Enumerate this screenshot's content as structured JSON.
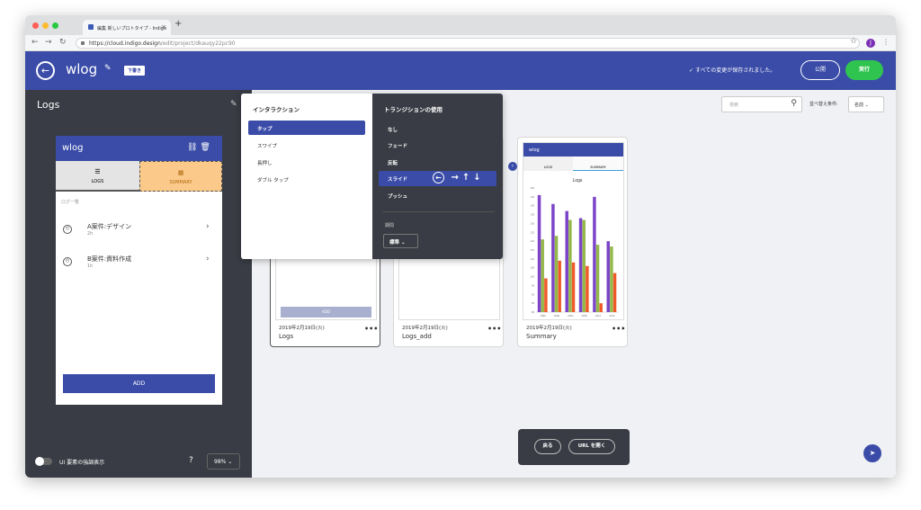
{
  "browser": {
    "tab_title": "編集 新しいプロトタイプ - Indigo",
    "tab_close": "×",
    "new_tab": "+",
    "url_host": "https://cloud.indigo.design",
    "url_path": "/edit/project/dkauqy22pc90",
    "profile_initial": "J",
    "colors": {
      "close": "#fd5e56",
      "minimize": "#fdbb2e",
      "maximize": "#28c941"
    }
  },
  "header": {
    "project_title": "wlog",
    "draft_badge": "下書き",
    "saved_status": "すべての変更が保存されました。",
    "publish_label": "公開",
    "run_label": "実行",
    "colors": {
      "bar": "#3a4ca8",
      "run": "#2fc44f"
    }
  },
  "sidebar": {
    "title": "Logs",
    "phone": {
      "title": "wlog",
      "tabs": [
        {
          "label": "LOGS",
          "icon": "list-icon"
        },
        {
          "label": "SUMMARY",
          "icon": "chart-icon"
        }
      ],
      "section_label": "ログ一覧",
      "rows": [
        {
          "title": "A案件:デザイン",
          "sub": "2h"
        },
        {
          "title": "B案件:資料作成",
          "sub": "1h"
        }
      ],
      "add_label": "ADD"
    },
    "highlight_label": "UI 要素の強調表示",
    "help": "?",
    "zoom": "98%"
  },
  "toolbar": {
    "search_placeholder": "検索",
    "sort_label": "並べ替え条件:",
    "sort_value": "名前"
  },
  "cards": [
    {
      "date": "2019年2月19日(火)",
      "name": "Logs",
      "more": "•••",
      "inner_add": "ADD"
    },
    {
      "date": "2019年2月19日(火)",
      "name": "Logs_add",
      "more": "•••"
    },
    {
      "date": "2019年2月19日(火)",
      "name": "Summary",
      "more": "•••",
      "inner_title": "wlog",
      "inner_tabs": [
        "LOGS",
        "SUMMARY"
      ],
      "chart_title": "Logs"
    }
  ],
  "interaction_popup": {
    "interaction_title": "インタラクション",
    "interactions": [
      "タップ",
      "スワイプ",
      "長押し",
      "ダブル タップ"
    ],
    "selected_interaction": "タップ",
    "transition_title": "トランジションの使用",
    "transitions": [
      "なし",
      "フェード",
      "反転",
      "スライド",
      "プッシュ"
    ],
    "selected_transition": "スライド",
    "directions": [
      "←",
      "→",
      "↑",
      "↓"
    ],
    "duration_label": "期間",
    "duration_value": "標準"
  },
  "bottom_bar": {
    "back_label": "戻る",
    "open_url_label": "URL を開く"
  },
  "chart_data": {
    "type": "bar",
    "title": "Logs",
    "categories": [
      "1996",
      "2000",
      "2004",
      "2008",
      "2012",
      "2016"
    ],
    "ylim": [
      80,
      150
    ],
    "yticks": [
      80,
      85,
      90,
      95,
      100,
      105,
      110,
      115,
      120,
      125,
      130,
      135,
      140,
      145,
      150
    ],
    "series": [
      {
        "values": [
          146,
          141,
          137,
          133,
          145,
          120
        ],
        "color": "#7c44c8"
      },
      {
        "values": [
          121,
          123,
          132,
          132,
          118,
          117
        ],
        "color": "#93b84a"
      },
      {
        "values": [
          99,
          109,
          108,
          106,
          85,
          102
        ],
        "color": "#f05a28"
      }
    ]
  }
}
